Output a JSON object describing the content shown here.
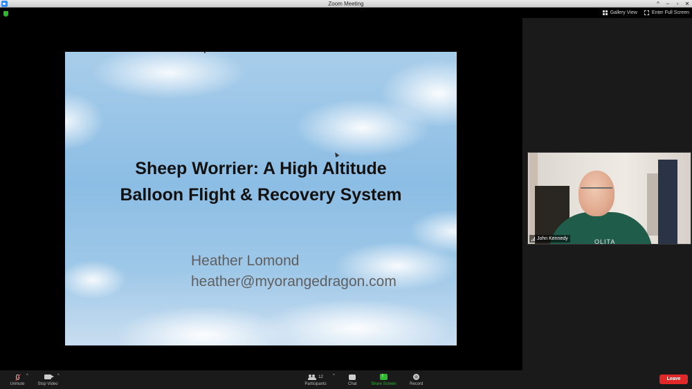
{
  "window": {
    "title": "Zoom Meeting",
    "controls": [
      "^",
      "–",
      "▫",
      "✕"
    ]
  },
  "top_bar": {
    "gallery_view_label": "Gallery View",
    "enter_full_screen_label": "Enter Full Screen"
  },
  "slide": {
    "title_line1": "Sheep Worrier: A High Altitude",
    "title_line2": "Balloon Flight & Recovery System",
    "author": "Heather Lomond",
    "email": "heather@myorangedragon.com"
  },
  "video": {
    "participant_name": "John Kennedy",
    "shirt_text": "OLITA"
  },
  "toolbar": {
    "unmute_label": "Unmute",
    "stop_video_label": "Stop Video",
    "participants_label": "Participants",
    "participants_count": "12",
    "chat_label": "Chat",
    "share_screen_label": "Share Screen",
    "record_label": "Record",
    "leave_label": "Leave",
    "caret": "^"
  },
  "colors": {
    "share_screen_green": "#2eb82e",
    "leave_red": "#e02828",
    "zoom_blue": "#2d8cff"
  }
}
